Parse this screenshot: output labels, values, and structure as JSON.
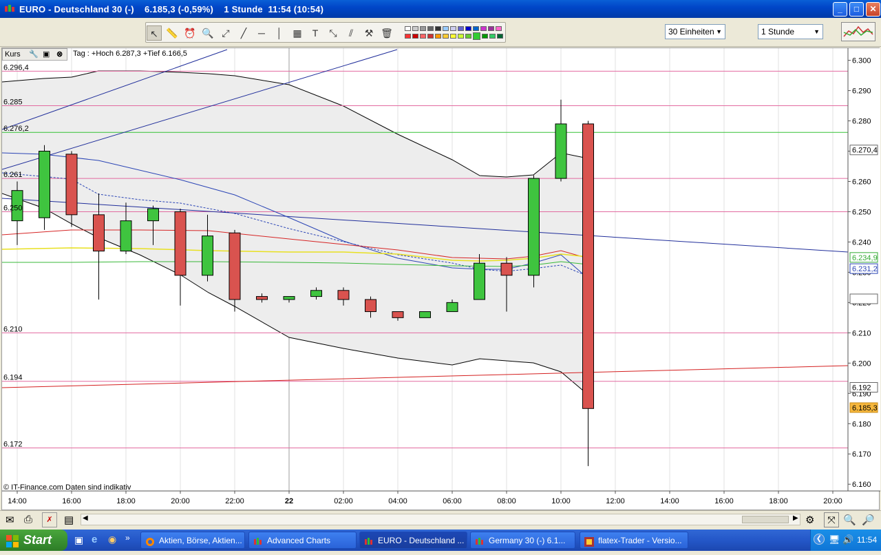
{
  "window": {
    "title": "EURO - Deutschland 30 (-)    6.185,3 (-0,59%)    1 Stunde  11:54 (10:54)",
    "minimize": "_",
    "maximize": "□",
    "close": "✕"
  },
  "toolbar": {
    "units_select": "30 Einheiten",
    "period_select": "1 Stunde"
  },
  "chart": {
    "panel_label": "Kurs",
    "tag_info": "Tag : +Hoch 6.287,3 +Tief 6.166,5",
    "credit": "© IT-Finance.com  Daten sind indikativ",
    "colors": {
      "bull": "#3fc43f",
      "bear": "#d9534f",
      "bollinger": "#000000",
      "fill": "#ededed"
    },
    "left_levels": [
      "6.296,4",
      "6.285",
      "6.276,2",
      "6.261",
      "6.250",
      "6.210",
      "6.194",
      "6.172"
    ],
    "right_badges": [
      "6.270,4",
      "6.234,9",
      "6.231,2",
      "6.192",
      "6.185,3"
    ]
  },
  "chart_data": {
    "type": "candlestick",
    "symbol": "EURO - Deutschland 30",
    "interval": "1 Stunde",
    "y_ticks": [
      "6.300",
      "6.290",
      "6.280",
      "6.270",
      "6.260",
      "6.250",
      "6.240",
      "6.230",
      "6.220",
      "6.210",
      "6.200",
      "6.190",
      "6.180",
      "6.170",
      "6.160"
    ],
    "x_ticks": [
      "14:00",
      "16:00",
      "18:00",
      "20:00",
      "22:00",
      "22",
      "02:00",
      "04:00",
      "06:00",
      "08:00",
      "10:00",
      "12:00",
      "14:00",
      "16:00",
      "18:00",
      "20:00"
    ],
    "ylim": [
      6158,
      6304
    ],
    "candles": [
      {
        "o": 6247,
        "h": 6260,
        "l": 6239,
        "c": 6257
      },
      {
        "o": 6248,
        "h": 6272,
        "l": 6244,
        "c": 6270
      },
      {
        "o": 6269,
        "h": 6270,
        "l": 6245,
        "c": 6249
      },
      {
        "o": 6249,
        "h": 6256,
        "l": 6221,
        "c": 6237
      },
      {
        "o": 6237,
        "h": 6253,
        "l": 6236,
        "c": 6247
      },
      {
        "o": 6247,
        "h": 6252,
        "l": 6239,
        "c": 6251
      },
      {
        "o": 6250,
        "h": 6251,
        "l": 6219,
        "c": 6229
      },
      {
        "o": 6229,
        "h": 6249,
        "l": 6227,
        "c": 6242
      },
      {
        "o": 6243,
        "h": 6244,
        "l": 6217,
        "c": 6221
      },
      {
        "o": 6222,
        "h": 6223,
        "l": 6220,
        "c": 6221
      },
      {
        "o": 6221,
        "h": 6222,
        "l": 6220,
        "c": 6222
      },
      {
        "o": 6222,
        "h": 6225,
        "l": 6221,
        "c": 6224
      },
      {
        "o": 6224,
        "h": 6225,
        "l": 6219,
        "c": 6221
      },
      {
        "o": 6221,
        "h": 6222,
        "l": 6215,
        "c": 6217
      },
      {
        "o": 6217,
        "h": 6217,
        "l": 6214,
        "c": 6215
      },
      {
        "o": 6215,
        "h": 6217,
        "l": 6215,
        "c": 6217
      },
      {
        "o": 6217,
        "h": 6221,
        "l": 6217,
        "c": 6220
      },
      {
        "o": 6221,
        "h": 6236,
        "l": 6221,
        "c": 6233
      },
      {
        "o": 6233,
        "h": 6235,
        "l": 6217,
        "c": 6229
      },
      {
        "o": 6229,
        "h": 6262,
        "l": 6225,
        "c": 6261
      },
      {
        "o": 6261,
        "h": 6287,
        "l": 6260,
        "c": 6279
      },
      {
        "o": 6279,
        "h": 6280,
        "l": 6166,
        "c": 6185
      }
    ],
    "hlines": [
      {
        "y": 6296.4,
        "color": "#e26aa0"
      },
      {
        "y": 6285,
        "color": "#e26aa0"
      },
      {
        "y": 6276.2,
        "color": "#35c235"
      },
      {
        "y": 6261,
        "color": "#e26aa0"
      },
      {
        "y": 6250,
        "color": "#e26aa0"
      },
      {
        "y": 6210,
        "color": "#e26aa0"
      },
      {
        "y": 6194,
        "color": "#e26aa0"
      },
      {
        "y": 6172,
        "color": "#e26aa0"
      }
    ]
  },
  "bottombar": {},
  "taskbar": {
    "start_label": "Start",
    "tasks": [
      {
        "label": "Aktien, Börse, Aktien..."
      },
      {
        "label": "Advanced Charts"
      },
      {
        "label": "EURO - Deutschland ..."
      },
      {
        "label": "Germany 30 (-)    6.1..."
      },
      {
        "label": "flatex-Trader - Versio..."
      }
    ],
    "clock": "11:54"
  }
}
